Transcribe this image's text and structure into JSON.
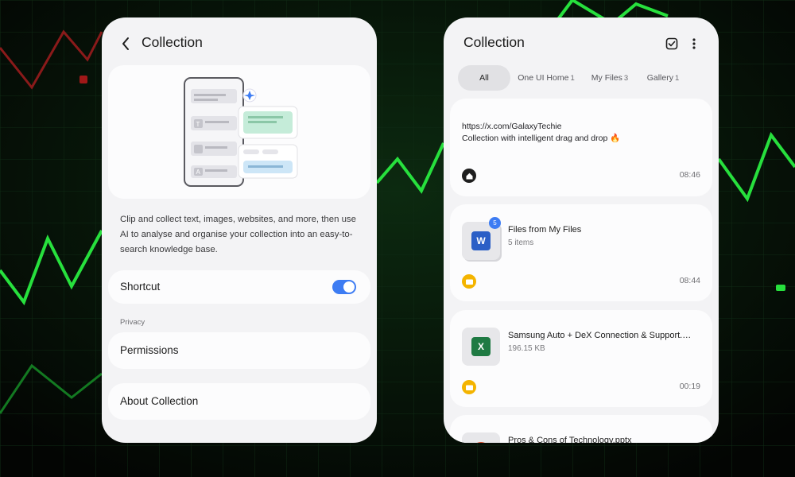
{
  "settings_screen": {
    "title": "Collection",
    "description": "Clip and collect text, images, websites, and more, then use AI to analyse and organise your collection into an easy-to-search knowledge base.",
    "shortcut_label": "Shortcut",
    "shortcut_enabled": true,
    "section_privacy": "Privacy",
    "permissions_label": "Permissions",
    "about_label": "About Collection",
    "illustration_letters": [
      "T",
      "A"
    ]
  },
  "collection_screen": {
    "title": "Collection",
    "filters": [
      {
        "label": "All",
        "count": ""
      },
      {
        "label": "One UI Home",
        "count": "1"
      },
      {
        "label": "My Files",
        "count": "3"
      },
      {
        "label": "Gallery",
        "count": "1"
      }
    ],
    "items": [
      {
        "type": "link",
        "line1": "https://x.com/GalaxyTechie",
        "line2": "Collection with intelligent drag and drop 🔥",
        "source_icon": "home-icon",
        "time": "08:46"
      },
      {
        "type": "file-group",
        "title": "Files from My Files",
        "subtitle": "5 items",
        "badge": "5",
        "thumb_letter": "W",
        "source_icon": "folder-icon",
        "time": "08:44"
      },
      {
        "type": "file",
        "title": "Samsung Auto + DeX Connection & Support.…",
        "subtitle": "196.15 KB",
        "thumb_letter": "X",
        "source_icon": "folder-icon",
        "time": "00:19"
      },
      {
        "type": "file",
        "title": "Pros & Cons of Technology.pptx"
      }
    ]
  },
  "colors": {
    "accent": "#3d7cf3",
    "background": "#050805",
    "chart_line": "#27e03d",
    "chart_line_red": "#8a1a1a",
    "word_blue": "#2b5fc6",
    "excel_green": "#1f7a43",
    "folder_yellow": "#f4b400"
  }
}
